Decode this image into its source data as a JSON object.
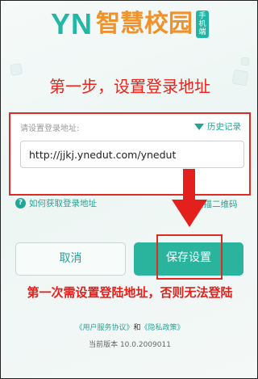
{
  "logo": {
    "brand": "YN",
    "name": "智慧校园",
    "badge": "手机端"
  },
  "step_title": "第一步，设置登录地址",
  "form": {
    "label": "请设置登录地址:",
    "history_label": "历史记录",
    "url_value": "http://jjkj.ynedut.com/ynedut"
  },
  "help_link": "如何获取登录地址",
  "scan_link": "扫描二维码",
  "buttons": {
    "cancel": "取消",
    "save": "保存设置"
  },
  "annotation": "第一次需设置登陆地址，否则无法登陆",
  "footer": {
    "user_agreement": "《用户服务协议》",
    "and": "和",
    "privacy_policy": "《隐私政策》",
    "version": "当前版本 10.0.2009011"
  },
  "colors": {
    "accent": "#23a596",
    "annotation_red": "#e3201b",
    "logo_orange": "#f0922a"
  },
  "icons": {
    "history": "triangle-down-icon",
    "help": "question-circle-icon",
    "annotation_arrow": "arrow-down-icon"
  }
}
